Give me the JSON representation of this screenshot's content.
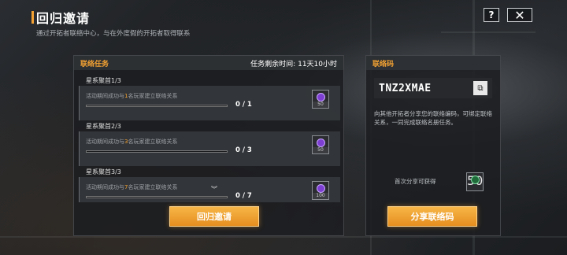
{
  "header": {
    "title": "回归邀请",
    "subtitle": "通过开拓者联络中心，与在外度假的开拓者取得联系"
  },
  "top_buttons": {
    "help": "?",
    "close": "✕"
  },
  "tasks_panel": {
    "title": "联络任务",
    "timer_label": "任务剩余时间:",
    "timer_value": "11天10小时",
    "tasks": [
      {
        "name": "星系聚首1/3",
        "desc_prefix": "活动期间成功与",
        "desc_count": "1",
        "desc_suffix": "名玩家建立联络关系",
        "progress": "0 / 1",
        "progress_fraction": 0,
        "reward_qty": "50",
        "reward_icon": "purple-gem-icon"
      },
      {
        "name": "星系聚首2/3",
        "desc_prefix": "活动期间成功与",
        "desc_count": "3",
        "desc_suffix": "名玩家建立联络关系",
        "progress": "0 / 3",
        "progress_fraction": 0,
        "reward_qty": "50",
        "reward_icon": "purple-gem-icon"
      },
      {
        "name": "星系聚首3/3",
        "desc_prefix": "活动期间成功与",
        "desc_count": "7",
        "desc_suffix": "名玩家建立联络关系",
        "progress": "0 / 7",
        "progress_fraction": 0,
        "reward_qty": "100",
        "reward_icon": "purple-gem-icon"
      }
    ],
    "action_button": "回归邀请"
  },
  "code_panel": {
    "title": "联络码",
    "code": "TNZ2XMAE",
    "description": "向其他开拓者分享您的联络编码，可绑定联络关系，一同完成联络名册任务。",
    "first_share_label": "首次分享可获得",
    "first_share_qty": "50",
    "action_button": "分享联络码"
  },
  "colors": {
    "accent": "#f3a233",
    "panel": "#1c1e21"
  }
}
